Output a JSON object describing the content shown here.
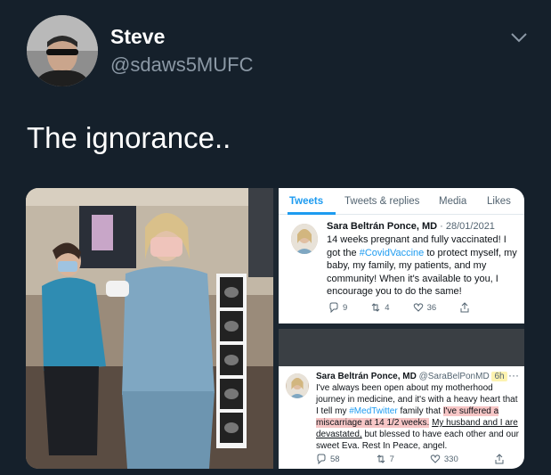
{
  "author": {
    "name": "Steve",
    "handle": "@sdaws5MUFC"
  },
  "tweet": {
    "text": "The ignorance.."
  },
  "embedded_profile": {
    "tabs": [
      "Tweets",
      "Tweets & replies",
      "Media",
      "Likes"
    ],
    "active_tab": "Tweets",
    "tweet": {
      "name": "Sara Beltrán Ponce, MD",
      "date": "· 28/01/2021",
      "text_before": "14 weeks pregnant and fully vaccinated! I got the ",
      "hashtag": "#CovidVaccine",
      "text_after": " to protect myself, my baby, my family, my patients, and my community! When it's available to you, I encourage you to do the same!",
      "replies": "9",
      "retweets": "4",
      "likes": "36"
    }
  },
  "embedded_followup": {
    "name": "Sara Beltrán Ponce, MD",
    "handle": "@SaraBelPonMD",
    "time": "6h",
    "menu": "···",
    "text_1": "I've always been open about my motherhood journey in medicine, and it's with a heavy heart that I tell my ",
    "hashtag": "#MedTwitter",
    "text_2": " family that ",
    "highlight": "I've suffered a miscarriage at 14 1/2 weeks.",
    "text_3": " ",
    "underlined": "My husband and I are devastated,",
    "text_4": " but blessed to have each other and our sweet Eva. Rest In Peace, angel.",
    "replies": "58",
    "retweets": "7",
    "likes": "330"
  },
  "colors": {
    "background": "#15202b",
    "accent": "#1d9bf0",
    "secondary_text": "#8b98a5"
  },
  "icons": [
    "chevron-down-icon",
    "reply-icon",
    "retweet-icon",
    "like-icon",
    "share-icon"
  ]
}
